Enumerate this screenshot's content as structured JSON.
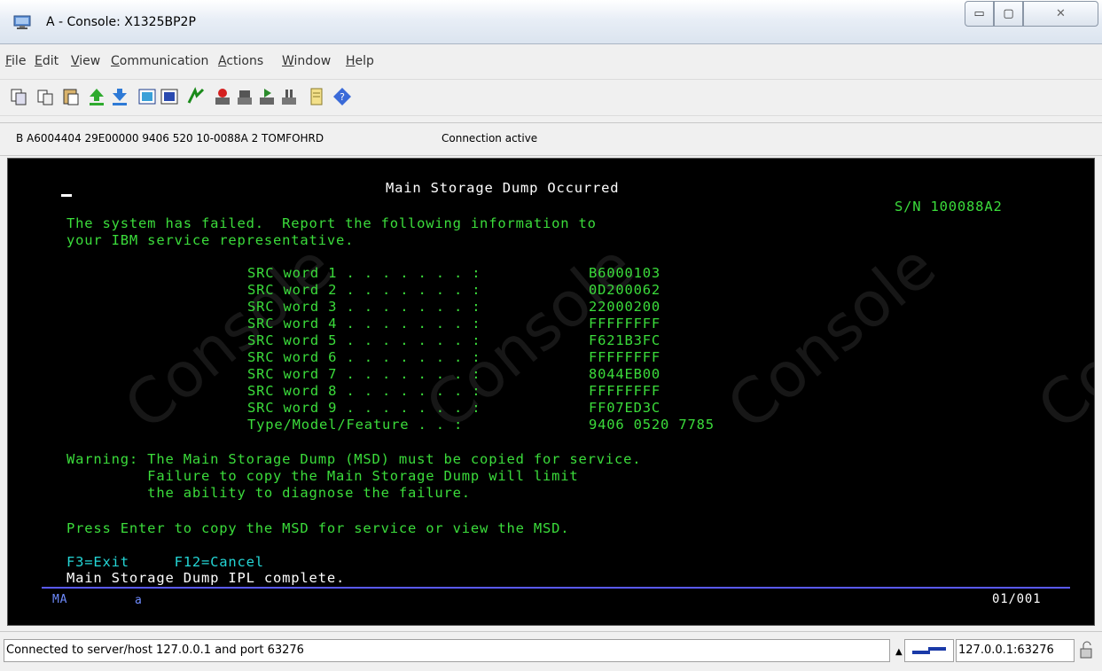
{
  "window": {
    "title": "A - Console: X1325BP2P",
    "controls": {
      "minimize": "▭",
      "maximize": "▢",
      "close": "✕"
    }
  },
  "menu": [
    "File",
    "Edit",
    "View",
    "Communication",
    "Actions",
    "Window",
    "Help"
  ],
  "toolbar_icons": [
    "copy-icon",
    "paste-icon",
    "paste-special-icon",
    "send-file-icon",
    "receive-file-icon",
    "display-icon",
    "keypad-icon",
    "macro-icon",
    "record-macro-icon",
    "stop-macro-icon",
    "play-macro-icon",
    "pause-macro-icon",
    "notes-icon",
    "help-icon"
  ],
  "session": {
    "info": "B A6004404 29E00000 9406 520 10-0088A 2 TOMFOHRD",
    "status": "Connection active"
  },
  "terminal": {
    "watermark": "Console",
    "title": "Main Storage Dump Occurred",
    "serial": "S/N 100088A2",
    "intro_1": "The system has failed.  Report the following information to",
    "intro_2": "your IBM service representative.",
    "src_words": [
      {
        "label": "SRC word 1 . . . . . . . :",
        "value": "B6000103"
      },
      {
        "label": "SRC word 2 . . . . . . . :",
        "value": "0D200062"
      },
      {
        "label": "SRC word 3 . . . . . . . :",
        "value": "22000200"
      },
      {
        "label": "SRC word 4 . . . . . . . :",
        "value": "FFFFFFFF"
      },
      {
        "label": "SRC word 5 . . . . . . . :",
        "value": "F621B3FC"
      },
      {
        "label": "SRC word 6 . . . . . . . :",
        "value": "FFFFFFFF"
      },
      {
        "label": "SRC word 7 . . . . . . . :",
        "value": "8044EB00"
      },
      {
        "label": "SRC word 8 . . . . . . . :",
        "value": "FFFFFFFF"
      },
      {
        "label": "SRC word 9 . . . . . . . :",
        "value": "FF07ED3C"
      },
      {
        "label": "Type/Model/Feature . . :",
        "value": "9406 0520 7785"
      }
    ],
    "warning_1": "Warning: The Main Storage Dump (MSD) must be copied for service.",
    "warning_2": "         Failure to copy the Main Storage Dump will limit",
    "warning_3": "         the ability to diagnose the failure.",
    "press": "Press Enter to copy the MSD for service or view the MSD.",
    "fkeys": "F3=Exit     F12=Cancel",
    "message": "Main Storage Dump IPL complete.",
    "oia_left": "MA",
    "oia_mode": "a",
    "oia_pos": "01/001"
  },
  "statusbar": {
    "message": "Connected to server/host 127.0.0.1 and port 63276",
    "host": "127.0.0.1:63276"
  },
  "colors": {
    "terminal_green": "#3bdc3b",
    "terminal_bg": "#000000",
    "oia_line": "#5a5aff"
  }
}
